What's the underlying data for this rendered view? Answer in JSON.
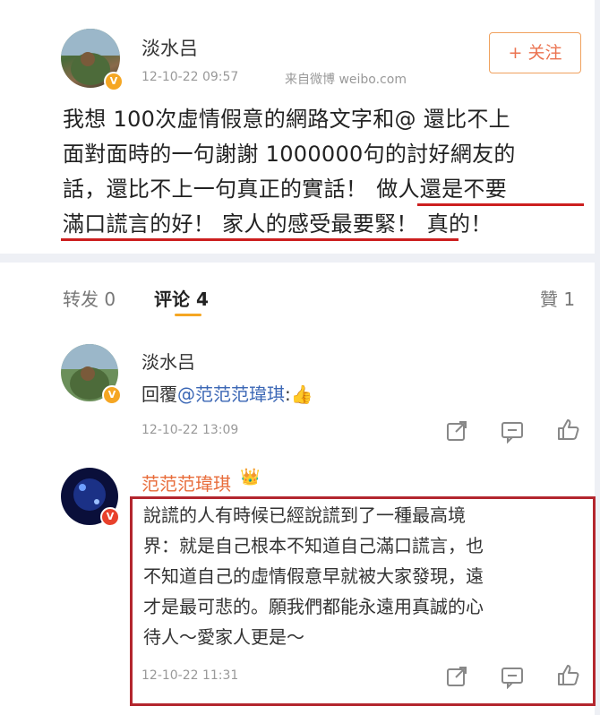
{
  "post": {
    "author": "淡水吕",
    "timestamp": "12-10-22 09:57",
    "source": "来自微博 weibo.com",
    "follow_label": "+ 关注",
    "text_line1": "我想 100次虛情假意的網路文字和@ 還比不上",
    "text_line2": "面對面時的一句謝謝 1000000句的討好網友的",
    "text_line3a": "話，還比不上一句真正的實話！",
    "text_line3b": "做人還是不要",
    "text_line4a": "滿口謊言的好！ 家人的感受最要緊！",
    "text_line4b": "真的！"
  },
  "tabs": {
    "repost": "转发 0",
    "comment": "评论 4",
    "like": "贊 1"
  },
  "comments": [
    {
      "author": "淡水吕",
      "reply_prefix": "回覆",
      "mention": "@范范范瑋琪",
      "reply_suffix": ":",
      "emoji": "👍",
      "timestamp": "12-10-22 13:09"
    },
    {
      "author": "范范范瑋琪",
      "crown": "👑",
      "line1": "說謊的人有時候已經說謊到了一種最高境",
      "line2": "界：就是自己根本不知道自己滿口謊言，也",
      "line3": "不知道自己的虛情假意早就被大家發現，遠",
      "line4": "才是最可悲的。願我們都能永遠用真誠的心",
      "line5": "待人～愛家人更是～",
      "timestamp": "12-10-22 11:31"
    }
  ],
  "colors": {
    "accent_orange": "#eb7350",
    "highlight_red": "#cc1f1f",
    "mention_blue": "#3b67b5",
    "verified_gold": "#f5a623"
  }
}
